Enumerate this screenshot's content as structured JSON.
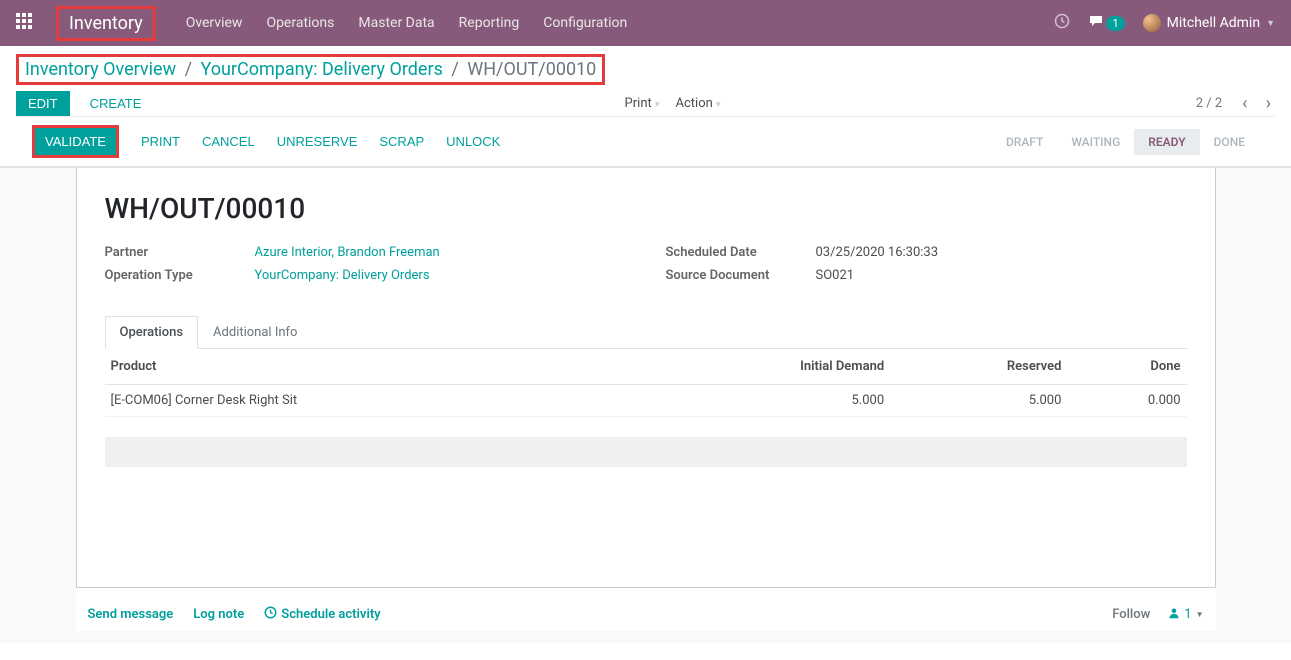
{
  "header": {
    "brand": "Inventory",
    "nav": [
      "Overview",
      "Operations",
      "Master Data",
      "Reporting",
      "Configuration"
    ],
    "msg_count": "1",
    "user": "Mitchell Admin"
  },
  "breadcrumb": {
    "items": [
      "Inventory Overview",
      "YourCompany: Delivery Orders"
    ],
    "current": "WH/OUT/00010"
  },
  "cp": {
    "edit": "EDIT",
    "create": "CREATE",
    "print": "Print",
    "action": "Action",
    "pager": "2 / 2"
  },
  "actions": {
    "validate": "VALIDATE",
    "print": "PRINT",
    "cancel": "CANCEL",
    "unreserve": "UNRESERVE",
    "scrap": "SCRAP",
    "unlock": "UNLOCK"
  },
  "status": {
    "draft": "DRAFT",
    "waiting": "WAITING",
    "ready": "READY",
    "done": "DONE"
  },
  "record": {
    "title": "WH/OUT/00010",
    "partner_label": "Partner",
    "partner": "Azure Interior, Brandon Freeman",
    "optype_label": "Operation Type",
    "optype": "YourCompany: Delivery Orders",
    "sched_label": "Scheduled Date",
    "sched": "03/25/2020 16:30:33",
    "source_label": "Source Document",
    "source": "SO021"
  },
  "tabs": {
    "operations": "Operations",
    "additional": "Additional Info"
  },
  "cols": {
    "product": "Product",
    "initial": "Initial Demand",
    "reserved": "Reserved",
    "done": "Done"
  },
  "lines": [
    {
      "product": "[E-COM06] Corner Desk Right Sit",
      "initial": "5.000",
      "reserved": "5.000",
      "done": "0.000"
    }
  ],
  "chatter": {
    "send": "Send message",
    "log": "Log note",
    "schedule": "Schedule activity",
    "follow": "Follow",
    "followers": "1"
  }
}
